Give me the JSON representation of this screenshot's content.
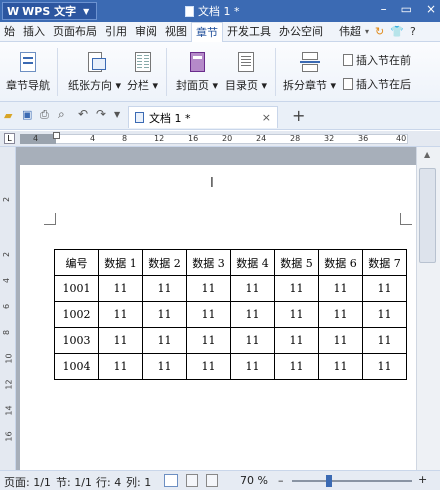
{
  "titlebar": {
    "app_name": "WPS 文字",
    "doc_title": "文档 1 *",
    "controls": [
      "–",
      "▭",
      "×"
    ]
  },
  "menu": [
    "始",
    "插入",
    "页面布局",
    "引用",
    "审阅",
    "视图",
    "章节",
    "开发工具",
    "办公空间"
  ],
  "menu_active_index": 6,
  "menu_right": {
    "user": "伟超"
  },
  "ribbon": {
    "section_nav": "章节导航",
    "orientation": "纸张方向",
    "columns": "分栏",
    "cover": "封面页",
    "toc": "目录页",
    "split_section": "拆分章节",
    "insert_before": "插入节在前",
    "insert_after": "插入节在后"
  },
  "quickbar": {
    "doc_tab": "文档 1 *",
    "add_tab": "+"
  },
  "ruler": {
    "numbers": [
      "4",
      "4",
      "8",
      "12",
      "16",
      "20",
      "24",
      "28",
      "32",
      "36",
      "40"
    ]
  },
  "vruler": {
    "numbers": [
      "2",
      "2",
      "4",
      "6",
      "8",
      "10",
      "12",
      "14",
      "16"
    ]
  },
  "table": {
    "headers": [
      "编号",
      "数据 1",
      "数据 2",
      "数据 3",
      "数据 4",
      "数据 5",
      "数据 6",
      "数据 7"
    ],
    "rows": [
      [
        "1001",
        "11",
        "11",
        "11",
        "11",
        "11",
        "11",
        "11"
      ],
      [
        "1002",
        "11",
        "11",
        "11",
        "11",
        "11",
        "11",
        "11"
      ],
      [
        "1003",
        "11",
        "11",
        "11",
        "11",
        "11",
        "11",
        "11"
      ],
      [
        "1004",
        "11",
        "11",
        "11",
        "11",
        "11",
        "11",
        "11"
      ]
    ]
  },
  "status": {
    "page": "页面: 1/1",
    "section": "节: 1/1",
    "row": "行: 4",
    "col": "列: 1",
    "zoom": "70 %",
    "zoom_minus": "–",
    "zoom_plus": "+"
  }
}
